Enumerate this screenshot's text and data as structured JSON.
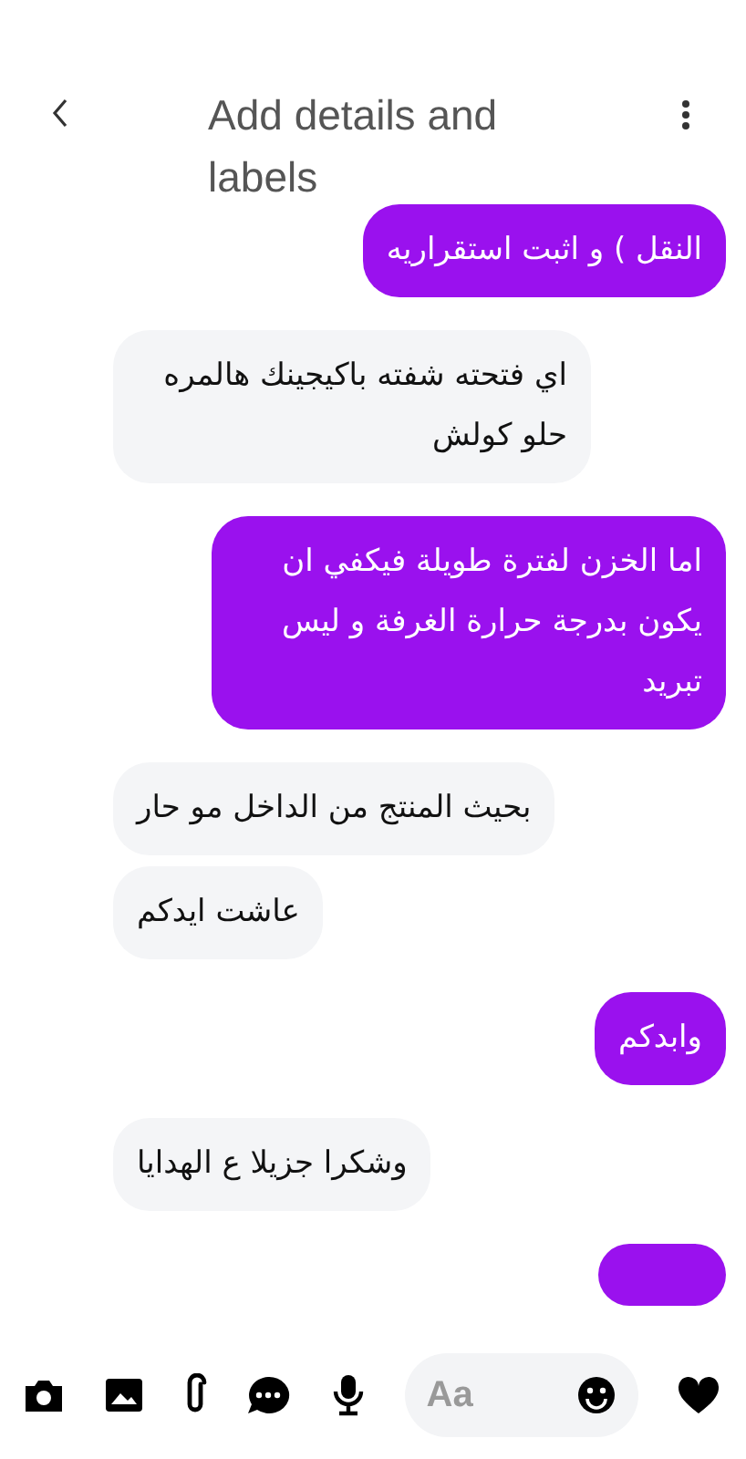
{
  "header": {
    "title": "Add details and labels"
  },
  "messages": [
    {
      "kind": "sent",
      "text": "النقل ) و اثبت استقراريه"
    },
    {
      "kind": "received",
      "text": "اي فتحته شفته باكيجينك هالمره حلو كولش"
    },
    {
      "kind": "sent",
      "text": "اما الخزن لفترة طويلة فيكفي ان يكون بدرجة حرارة الغرفة و ليس تبريد"
    },
    {
      "kind": "received",
      "text": "بحيث المنتج من الداخل مو حار"
    },
    {
      "kind": "received",
      "text": "عاشت ايدكم"
    },
    {
      "kind": "sent",
      "text": "وابدكم"
    },
    {
      "kind": "received",
      "text": "وشكرا جزيلا ع الهدايا"
    },
    {
      "kind": "sent"
    }
  ],
  "composer": {
    "placeholder": "Aa"
  }
}
